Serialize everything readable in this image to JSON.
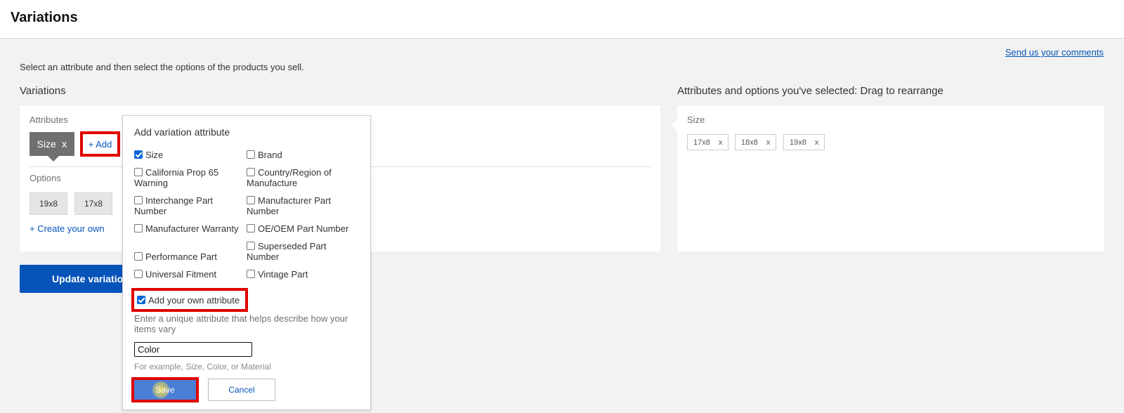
{
  "header": {
    "title": "Variations"
  },
  "feedback_link": "Send us your comments",
  "intro": "Select an attribute and then select the options of the products you sell.",
  "left": {
    "section_title": "Variations",
    "attributes_label": "Attributes",
    "attribute_chip": {
      "label": "Size",
      "remove": "x"
    },
    "add_link": "+ Add",
    "options_label": "Options",
    "options": [
      "19x8",
      "17x8"
    ],
    "create_own": "+ Create your own",
    "update_button": "Update variations"
  },
  "right": {
    "section_title": "Attributes and options you've selected: Drag to rearrange",
    "attribute_name": "Size",
    "selected_options": [
      {
        "label": "17x8",
        "remove": "x"
      },
      {
        "label": "18x8",
        "remove": "x"
      },
      {
        "label": "19x8",
        "remove": "x"
      }
    ]
  },
  "popup": {
    "title": "Add variation attribute",
    "checkboxes": [
      {
        "label": "Size",
        "checked": true
      },
      {
        "label": "Brand",
        "checked": false
      },
      {
        "label": "California Prop 65 Warning",
        "checked": false
      },
      {
        "label": "Country/Region of Manufacture",
        "checked": false
      },
      {
        "label": "Interchange Part Number",
        "checked": false
      },
      {
        "label": "Manufacturer Part Number",
        "checked": false
      },
      {
        "label": "Manufacturer Warranty",
        "checked": false
      },
      {
        "label": "OE/OEM Part Number",
        "checked": false
      },
      {
        "label": "Performance Part",
        "checked": false
      },
      {
        "label": "Superseded Part Number",
        "checked": false
      },
      {
        "label": "Universal Fitment",
        "checked": false
      },
      {
        "label": "Vintage Part",
        "checked": false
      }
    ],
    "own_attribute": {
      "label": "Add your own attribute",
      "checked": true
    },
    "hint": "Enter a unique attribute that helps describe how your items vary",
    "input_value": "Color",
    "example": "For example, Size, Color, or Material",
    "save_label": "Save",
    "cancel_label": "Cancel"
  },
  "colors": {
    "accent": "#0654ba",
    "highlight": "#e00000"
  }
}
